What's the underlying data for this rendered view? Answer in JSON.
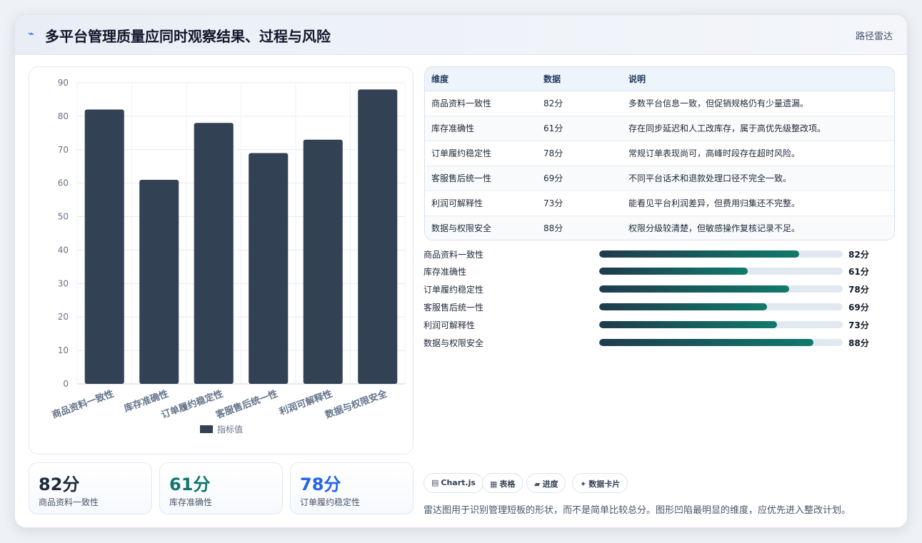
{
  "header": {
    "icon": "chart-line-icon",
    "title": "多平台管理质量应同时观察结果、过程与风险",
    "tag": "路径雷达"
  },
  "chart_data": {
    "type": "bar",
    "categories": [
      "商品资料一致性",
      "库存准确性",
      "订单履约稳定性",
      "客服售后统一性",
      "利润可解释性",
      "数据与权限安全"
    ],
    "series": [
      {
        "name": "指标值",
        "values": [
          82,
          61,
          78,
          69,
          73,
          88
        ]
      }
    ],
    "ylim": [
      0,
      90
    ],
    "yticks": [
      0,
      10,
      20,
      30,
      40,
      50,
      60,
      70,
      80,
      90
    ],
    "grid": true,
    "legend": "bottom",
    "bar_color": "#334155"
  },
  "stats": [
    {
      "value": "82分",
      "label": "商品资料一致性",
      "color": "#1e293b"
    },
    {
      "value": "61分",
      "label": "库存准确性",
      "color": "#0f766e"
    },
    {
      "value": "78分",
      "label": "订单履约稳定性",
      "color": "#2563eb"
    }
  ],
  "table": {
    "headers": [
      "维度",
      "数据",
      "说明"
    ],
    "rows": [
      [
        "商品资料一致性",
        "82分",
        "多数平台信息一致，但促销规格仍有少量遗漏。"
      ],
      [
        "库存准确性",
        "61分",
        "存在同步延迟和人工改库存，属于高优先级整改项。"
      ],
      [
        "订单履约稳定性",
        "78分",
        "常规订单表现尚可，高峰时段存在超时风险。"
      ],
      [
        "客服售后统一性",
        "69分",
        "不同平台话术和退款处理口径不完全一致。"
      ],
      [
        "利润可解释性",
        "73分",
        "能看见平台利润差异，但费用归集还不完整。"
      ],
      [
        "数据与权限安全",
        "88分",
        "权限分级较清楚，但敏感操作复核记录不足。"
      ]
    ]
  },
  "progress": [
    {
      "label": "商品资料一致性",
      "value": "82分",
      "score": 82
    },
    {
      "label": "库存准确性",
      "value": "61分",
      "score": 61
    },
    {
      "label": "订单履约稳定性",
      "value": "78分",
      "score": 78
    },
    {
      "label": "客服售后统一性",
      "value": "69分",
      "score": 69
    },
    {
      "label": "利润可解释性",
      "value": "73分",
      "score": 73
    },
    {
      "label": "数据与权限安全",
      "value": "88分",
      "score": 88
    }
  ],
  "chips": [
    {
      "icon": "▤",
      "label": "Chart.js"
    },
    {
      "icon": "▦",
      "label": "表格"
    },
    {
      "icon": "▰",
      "label": "进度"
    },
    {
      "icon": "✦",
      "label": "数据卡片"
    }
  ],
  "footnote": "雷达图用于识别管理短板的形状，而不是简单比较总分。图形凹陷最明显的维度，应优先进入整改计划。"
}
